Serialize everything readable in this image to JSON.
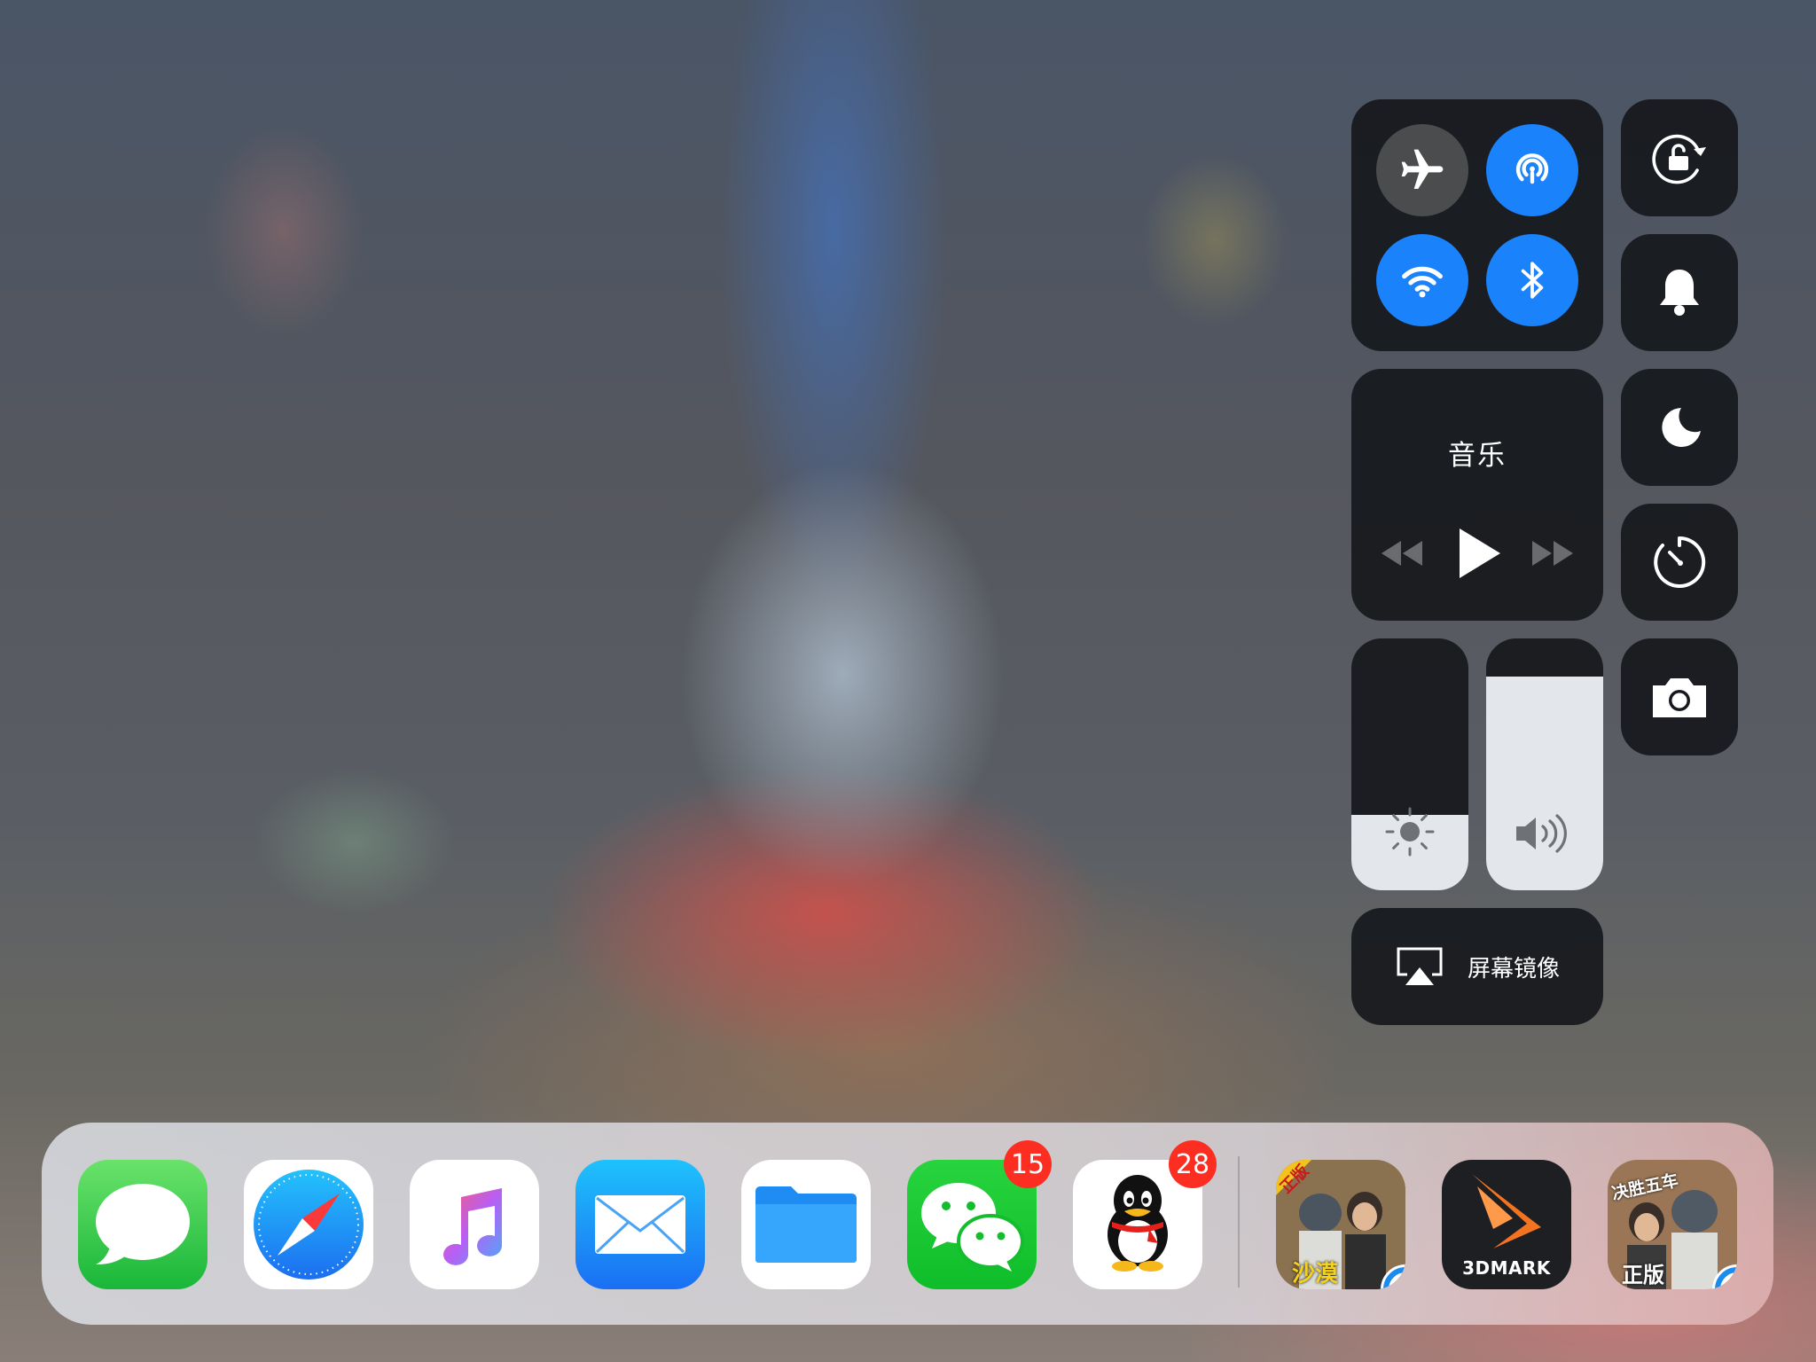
{
  "control_center": {
    "connectivity": {
      "airplane": {
        "icon": "airplane-icon",
        "state": "off"
      },
      "airdrop": {
        "icon": "airdrop-icon",
        "state": "on"
      },
      "wifi": {
        "icon": "wifi-icon",
        "state": "on"
      },
      "bluetooth": {
        "icon": "bluetooth-icon",
        "state": "on"
      }
    },
    "music": {
      "title": "音乐",
      "controls": [
        "rewind-icon",
        "play-icon",
        "fast-forward-icon"
      ]
    },
    "brightness": {
      "icon": "sun-icon",
      "level": 0.3
    },
    "volume": {
      "icon": "speaker-icon",
      "level": 0.85
    },
    "screen_mirroring": {
      "label": "屏幕镜像",
      "icon": "airplay-icon"
    },
    "side_buttons": [
      "orientation-lock-icon",
      "bell-icon",
      "moon-icon",
      "timer-icon",
      "camera-icon"
    ]
  },
  "dock": {
    "apps": [
      {
        "name": "Messages",
        "icon": "messages-icon"
      },
      {
        "name": "Safari",
        "icon": "safari-icon"
      },
      {
        "name": "Music",
        "icon": "music-icon"
      },
      {
        "name": "Mail",
        "icon": "mail-icon"
      },
      {
        "name": "Files",
        "icon": "files-icon"
      },
      {
        "name": "WeChat",
        "icon": "wechat-icon",
        "badge": "15"
      },
      {
        "name": "QQ",
        "icon": "qq-icon",
        "badge": "28"
      }
    ],
    "recent_apps": [
      {
        "name": "PUBG Desert",
        "icon": "pubg-desert-icon",
        "labels": [
          "正版",
          "沙漠"
        ]
      },
      {
        "name": "3DMark",
        "icon": "3dmark-icon",
        "label": "3DMARK"
      },
      {
        "name": "PUBG Mobile",
        "icon": "pubg-mobile-icon",
        "labels": [
          "决胜五车",
          "正版"
        ]
      }
    ]
  },
  "colors": {
    "accent_blue": "#1a82fb",
    "badge_red": "#fc2e22",
    "tile_dark": "#16181c"
  }
}
